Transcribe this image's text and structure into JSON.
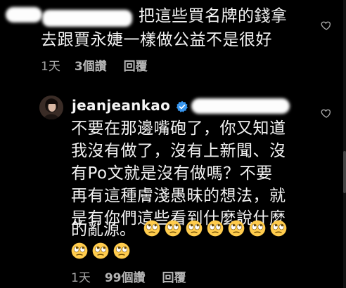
{
  "comment1": {
    "line1": "把這些買名牌的錢拿",
    "line2": "去跟賈永婕一樣做公益不是很好",
    "time": "1天",
    "likes": "3個讚",
    "reply": "回覆",
    "like_icon": "heart-outline-icon"
  },
  "comment2": {
    "username": "jeanjeankao",
    "verified_icon": "verified-badge-icon",
    "lines": [
      "不要在那邊嘴砲了，你又知道",
      "我沒有做了，沒有上新聞、沒",
      "有Po文就是沒有做嗎？不要",
      "再有這種膚淺愚昧的想法，就",
      "是有你們這些看到什麼說什麼",
      "的亂源。"
    ],
    "emoji_name": "face-with-rolling-eyes",
    "emoji_count_line1": 7,
    "emoji_count_line2": 3,
    "time": "1天",
    "likes": "99個讚",
    "reply": "回覆",
    "like_icon": "heart-outline-icon"
  },
  "colors": {
    "background": "#000000",
    "text": "#f2f2f2",
    "meta": "#a8a8a8",
    "verified": "#3897f0",
    "emoji_face": "#ffcc4d"
  }
}
